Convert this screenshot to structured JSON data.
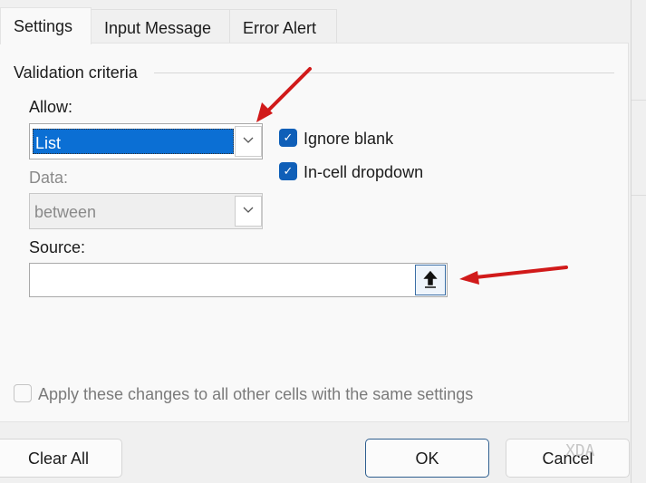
{
  "tabs": [
    {
      "label": "Settings",
      "active": true
    },
    {
      "label": "Input Message"
    },
    {
      "label": "Error Alert"
    }
  ],
  "section_title": "Validation criteria",
  "allow": {
    "label": "Allow:",
    "value": "List"
  },
  "data": {
    "label": "Data:",
    "value": "between"
  },
  "checkboxes": {
    "ignore_blank": {
      "label": "Ignore blank",
      "checked": true
    },
    "in_cell_dropdown": {
      "label": "In-cell dropdown",
      "checked": true
    }
  },
  "source": {
    "label": "Source:",
    "value": ""
  },
  "apply_all": {
    "label": "Apply these changes to all other cells with the same settings",
    "checked": false
  },
  "buttons": {
    "clear_all": "Clear All",
    "ok": "OK",
    "cancel": "Cancel"
  },
  "watermark": "XDA",
  "colors": {
    "accent": "#0f5fb8",
    "selection": "#0b6fd4",
    "arrow": "#d11a1a"
  }
}
